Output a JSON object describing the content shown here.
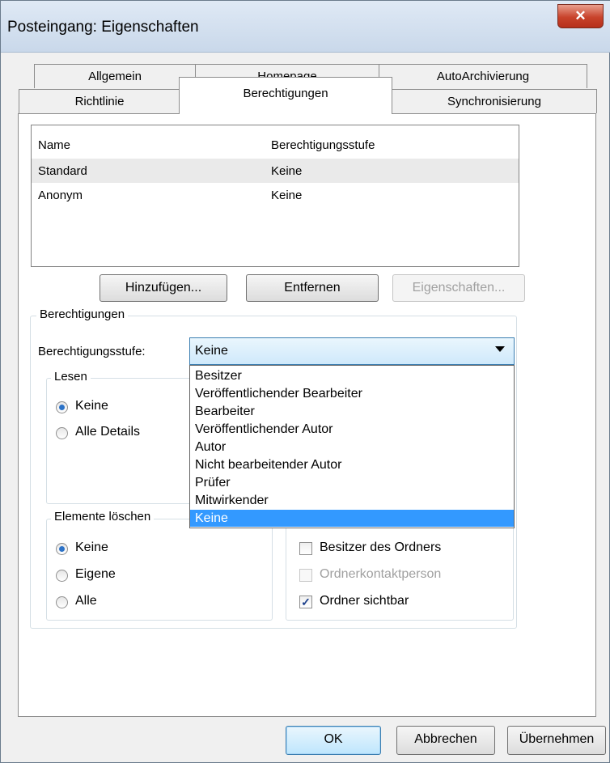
{
  "window": {
    "title": "Posteingang: Eigenschaften",
    "close_glyph": "✕"
  },
  "tabs": {
    "row1": [
      "Allgemein",
      "Homepage",
      "AutoArchivierung"
    ],
    "row2": [
      "Richtlinie",
      "Berechtigungen",
      "Synchronisierung"
    ],
    "active": "Berechtigungen"
  },
  "perm_list": {
    "col_name": "Name",
    "col_level": "Berechtigungsstufe",
    "rows": [
      {
        "name": "Standard",
        "level": "Keine"
      },
      {
        "name": "Anonym",
        "level": "Keine"
      }
    ]
  },
  "list_buttons": {
    "add": "Hinzufügen...",
    "remove": "Entfernen",
    "properties": "Eigenschaften..."
  },
  "permissions": {
    "group_label": "Berechtigungen",
    "level_label": "Berechtigungsstufe:",
    "level_value": "Keine",
    "level_options": [
      "Besitzer",
      "Veröffentlichender Bearbeiter",
      "Bearbeiter",
      "Veröffentlichender Autor",
      "Autor",
      "Nicht bearbeitender Autor",
      "Prüfer",
      "Mitwirkender",
      "Keine"
    ],
    "read": {
      "label": "Lesen",
      "options": [
        "Keine",
        "Alle Details"
      ],
      "selected": "Keine"
    },
    "delete": {
      "label": "Elemente löschen",
      "options": [
        "Keine",
        "Eigene",
        "Alle"
      ],
      "selected": "Keine"
    },
    "other": {
      "owner": {
        "label": "Besitzer des Ordners",
        "checked": false
      },
      "contact": {
        "label": "Ordnerkontaktperson",
        "checked": false,
        "enabled": false
      },
      "visible": {
        "label": "Ordner sichtbar",
        "checked": true,
        "glyph": "✓"
      }
    }
  },
  "footer": {
    "ok": "OK",
    "cancel": "Abbrechen",
    "apply": "Übernehmen"
  },
  "colors": {
    "selection": "#3399ff",
    "close": "#c8432b"
  }
}
